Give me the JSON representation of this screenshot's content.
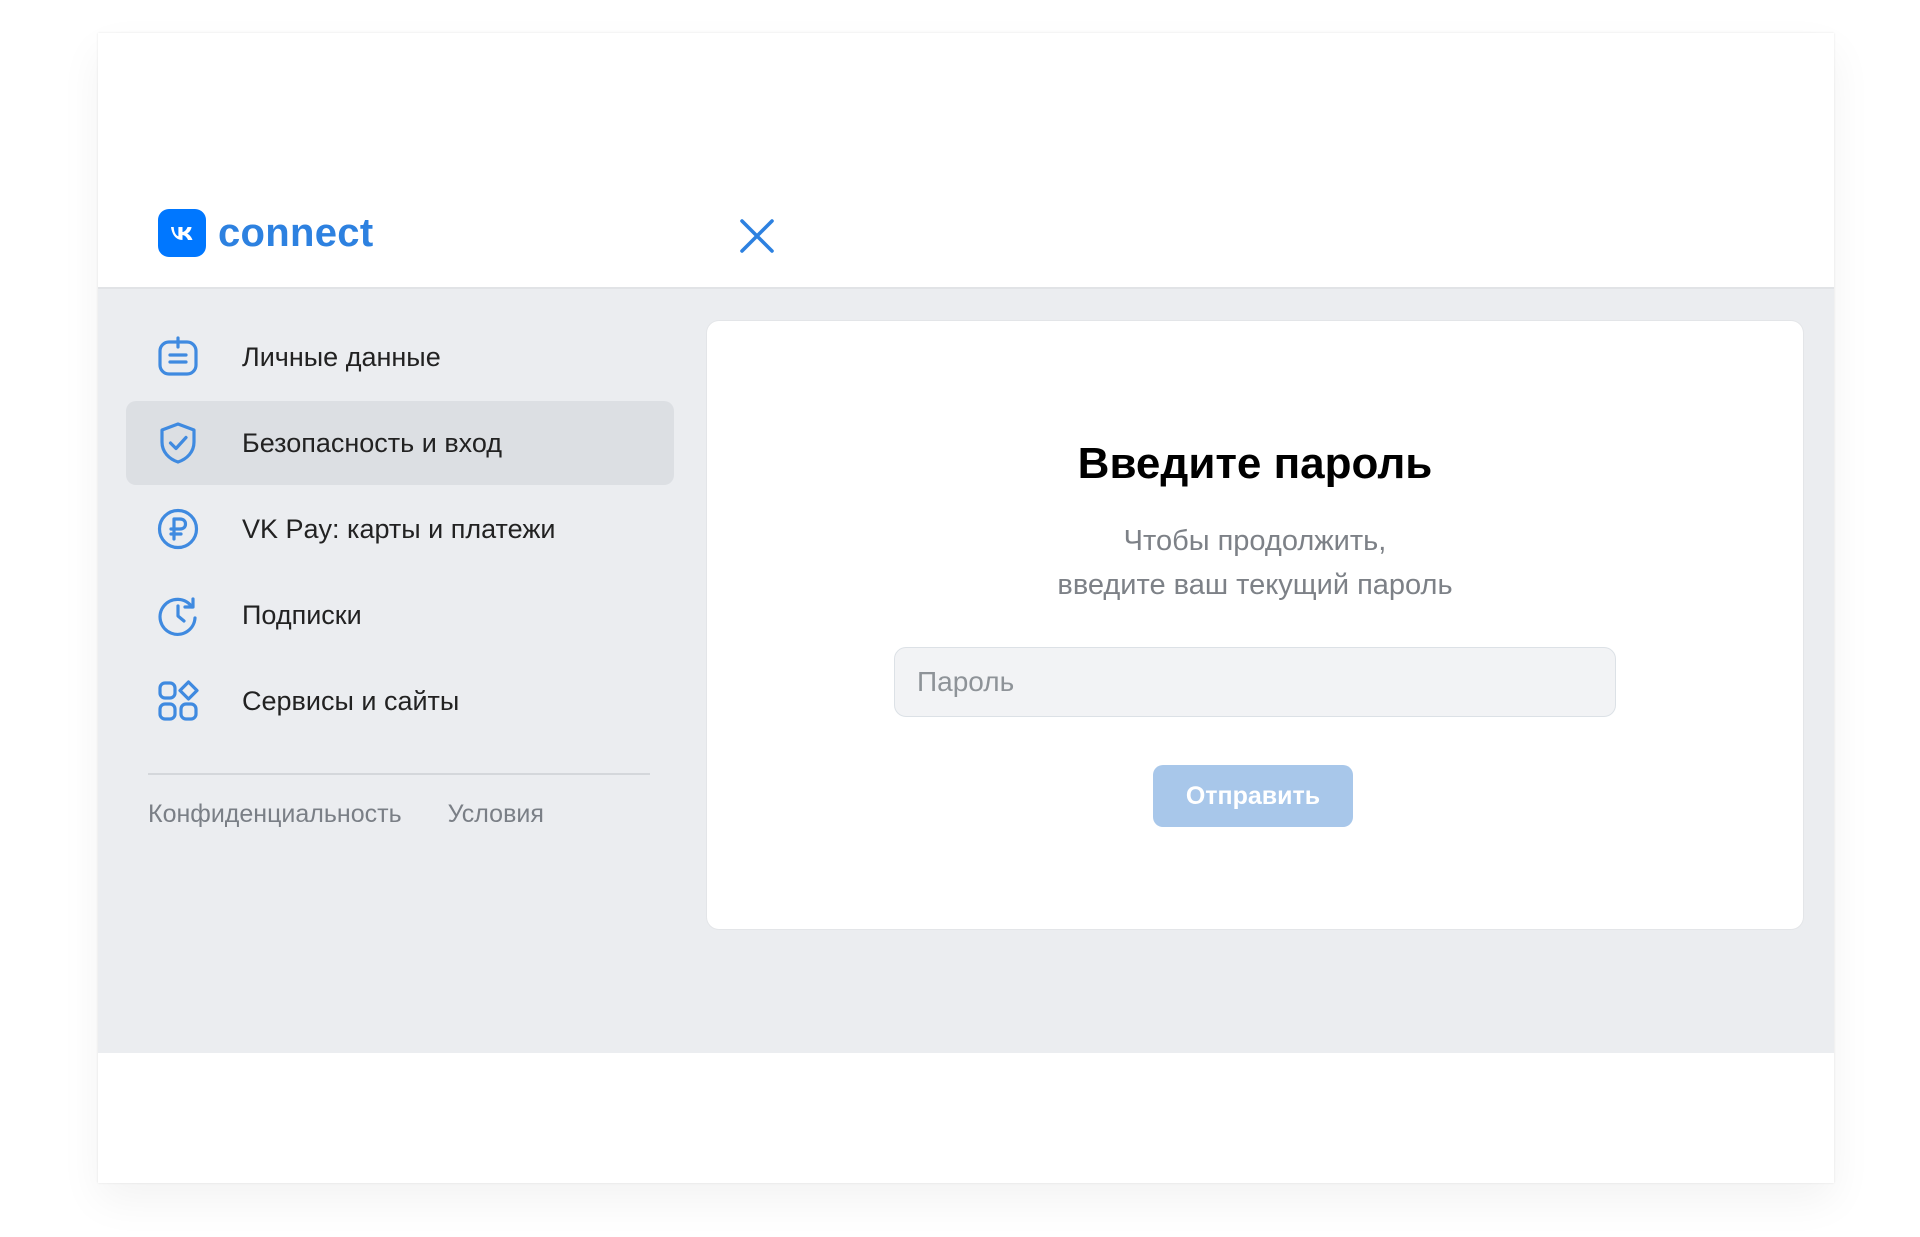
{
  "header": {
    "logo_text": "connect",
    "brand_color": "#0077ff",
    "logo_icon": "vk-logo-icon",
    "close_icon": "close-icon"
  },
  "sidebar": {
    "items": [
      {
        "label": "Личные данные",
        "icon": "personal-data-icon",
        "active": false
      },
      {
        "label": "Безопасность и вход",
        "icon": "shield-check-icon",
        "active": true
      },
      {
        "label": "VK Pay: карты и платежи",
        "icon": "ruble-icon",
        "active": false
      },
      {
        "label": "Подписки",
        "icon": "subscription-clock-icon",
        "active": false
      },
      {
        "label": "Сервисы и сайты",
        "icon": "services-grid-icon",
        "active": false
      }
    ],
    "footer": {
      "privacy": "Конфиденциальность",
      "terms": "Условия"
    }
  },
  "card": {
    "title": "Введите пароль",
    "subtitle_line1": "Чтобы продолжить,",
    "subtitle_line2": "введите ваш текущий пароль",
    "input_placeholder": "Пароль",
    "input_value": "",
    "submit_label": "Отправить",
    "submit_color": "#a8c7ea"
  }
}
